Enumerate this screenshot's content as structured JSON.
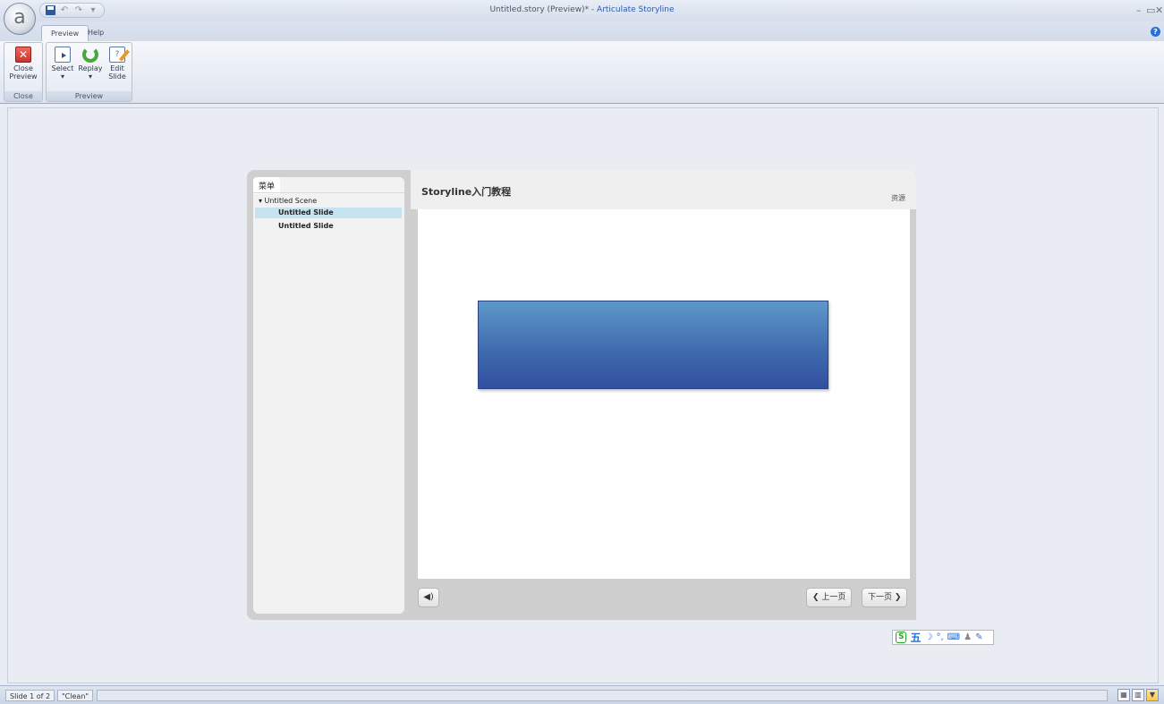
{
  "window": {
    "doc_title": "Untitled.story (Preview)* - ",
    "app_name": "Articulate Storyline",
    "minimize": "–",
    "restore": "▭",
    "close": "✕"
  },
  "orb": {
    "glyph": "a"
  },
  "qat": {
    "undo": "↶",
    "redo": "↷",
    "more": "▾"
  },
  "tabs": [
    {
      "label": "Preview",
      "active": true
    },
    {
      "label": "Help",
      "active": false
    }
  ],
  "help_icon": "?",
  "ribbon": {
    "groups": [
      {
        "label": "Close",
        "buttons": [
          {
            "label_line1": "Close",
            "label_line2": "Preview",
            "icon": "close-preview-icon",
            "glyph": "✕"
          }
        ]
      },
      {
        "label": "Preview",
        "buttons": [
          {
            "label_line1": "Select",
            "label_line2": "▾",
            "icon": "select-slide-icon"
          },
          {
            "label_line1": "Replay",
            "label_line2": "▾",
            "icon": "replay-icon"
          },
          {
            "label_line1": "Edit",
            "label_line2": "Slide",
            "icon": "edit-slide-icon",
            "glyph": "?"
          }
        ]
      }
    ]
  },
  "player": {
    "menu_tab": "菜单",
    "scene": "▾ Untitled Scene",
    "slides": [
      {
        "label": "Untitled Slide",
        "selected": true
      },
      {
        "label": "Untitled Slide",
        "selected": false
      }
    ],
    "course_title": "Storyline入门教程",
    "resources": "资源",
    "volume_glyph": "◀)",
    "prev": {
      "arrow": "❮",
      "label": "上一页"
    },
    "next": {
      "arrow": "❯",
      "label": "下一页"
    },
    "shape_colors": {
      "top": "#5c98c9",
      "bottom": "#3150a0"
    }
  },
  "ime": {
    "s": "S",
    "wubi": "五",
    "moon": "☽",
    "punct": "°,",
    "keyboard": "⌨",
    "user": "♟",
    "tool": "✎"
  },
  "status": {
    "slide_info": "Slide 1 of 2",
    "theme": "\"Clean\"",
    "views": [
      "▦",
      "▥",
      "▼"
    ]
  }
}
